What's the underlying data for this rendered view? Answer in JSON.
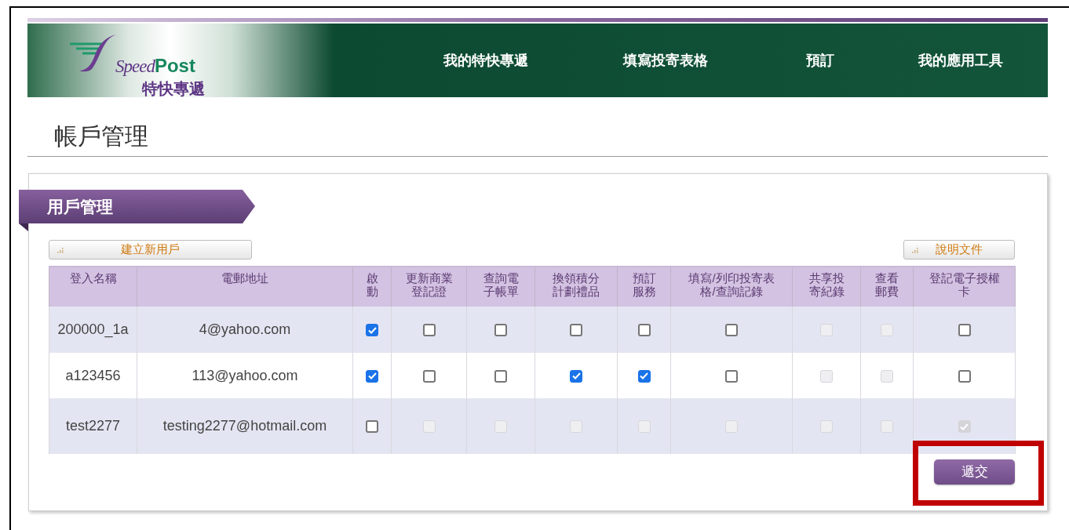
{
  "logo": {
    "word_1": "Speed",
    "word_2": "Post",
    "subtitle": "特快專遞"
  },
  "nav": [
    {
      "label": "我的特快專遞"
    },
    {
      "label": "填寫投寄表格"
    },
    {
      "label": "預訂"
    },
    {
      "label": "我的應用工具"
    }
  ],
  "page_title": "帳戶管理",
  "section_title": "用戶管理",
  "create_button": "建立新用戶",
  "help_button": "說明文件",
  "table": {
    "columns": [
      "登入名稱",
      "電郵地址",
      "啟動",
      "更新商業登記證",
      "查詢電子帳單",
      "換領積分計劃禮品",
      "預訂服務",
      "填寫/列印投寄表格/查詢記錄",
      "共享投寄紀錄",
      "查看郵費",
      "登記電子授權卡"
    ],
    "rows": [
      {
        "login": "200000_1a",
        "email": "4@yahoo.com",
        "permissions": [
          {
            "checked": true,
            "disabled": false
          },
          {
            "checked": false,
            "disabled": false
          },
          {
            "checked": false,
            "disabled": false
          },
          {
            "checked": false,
            "disabled": false
          },
          {
            "checked": false,
            "disabled": false
          },
          {
            "checked": false,
            "disabled": false
          },
          {
            "checked": false,
            "disabled": true
          },
          {
            "checked": false,
            "disabled": true
          },
          {
            "checked": false,
            "disabled": false
          }
        ]
      },
      {
        "login": "a123456",
        "email": "113@yahoo.com",
        "permissions": [
          {
            "checked": true,
            "disabled": false
          },
          {
            "checked": false,
            "disabled": false
          },
          {
            "checked": false,
            "disabled": false
          },
          {
            "checked": true,
            "disabled": false
          },
          {
            "checked": true,
            "disabled": false
          },
          {
            "checked": false,
            "disabled": false
          },
          {
            "checked": false,
            "disabled": true
          },
          {
            "checked": false,
            "disabled": true
          },
          {
            "checked": false,
            "disabled": false
          }
        ]
      },
      {
        "login": "test2277",
        "email": "testing2277@hotmail.com",
        "permissions": [
          {
            "checked": false,
            "disabled": false
          },
          {
            "checked": false,
            "disabled": true
          },
          {
            "checked": false,
            "disabled": true
          },
          {
            "checked": false,
            "disabled": true
          },
          {
            "checked": false,
            "disabled": true
          },
          {
            "checked": false,
            "disabled": true
          },
          {
            "checked": false,
            "disabled": true
          },
          {
            "checked": false,
            "disabled": true
          },
          {
            "checked": true,
            "disabled": true
          }
        ]
      }
    ]
  },
  "submit_button": "遞交"
}
